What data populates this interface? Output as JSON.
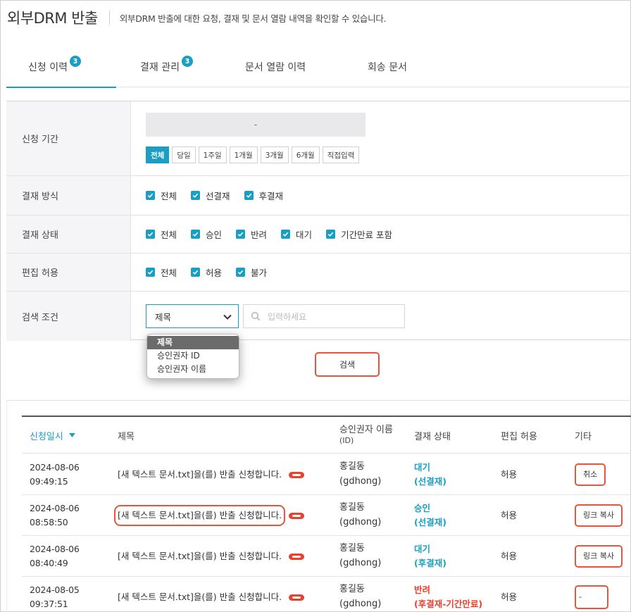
{
  "header": {
    "title": "외부DRM 반출",
    "description": "외부DRM 반출에 대한 요청, 결재 및 문서 열람 내역을 확인할 수 있습니다."
  },
  "tabs": [
    {
      "label": "신청 이력",
      "badge": "3",
      "active": true
    },
    {
      "label": "결재 관리",
      "badge": "3",
      "active": false
    },
    {
      "label": "문서 열람 이력",
      "badge": "",
      "active": false
    },
    {
      "label": "회송 문서",
      "badge": "",
      "active": false
    }
  ],
  "filters": {
    "period": {
      "label": "신청 기간",
      "range_separator": "-",
      "options": [
        "전체",
        "당일",
        "1주일",
        "1개월",
        "3개월",
        "6개월",
        "직접입력"
      ],
      "selected": "전체"
    },
    "approval_method": {
      "label": "결재 방식",
      "options": [
        "전체",
        "선결재",
        "후결재"
      ]
    },
    "approval_status": {
      "label": "결재 상태",
      "options": [
        "전체",
        "승인",
        "반려",
        "대기",
        "기간만료 포함"
      ]
    },
    "edit_permission": {
      "label": "편집 허용",
      "options": [
        "전체",
        "허용",
        "불가"
      ]
    },
    "search_condition": {
      "label": "검색 조건",
      "selected": "제목",
      "dropdown_options": [
        "제목",
        "승인권자 ID",
        "승인권자 이름"
      ],
      "placeholder": "입력하세요"
    },
    "search_button": "검색"
  },
  "table": {
    "columns": [
      "신청일시",
      "제목",
      "승인권자 이름",
      "(ID)",
      "결재 상태",
      "편집 허용",
      "기타"
    ],
    "rows": [
      {
        "date": "2024-08-06",
        "time": "09:49:15",
        "subject": "[새 텍스트 문서.txt]을(를) 반출 신청합니다.",
        "approver_name": "홍길동",
        "approver_id": "(gdhong)",
        "status": "대기",
        "status_sub": "(선결재)",
        "status_type": "approve",
        "edit": "허용",
        "etc": "취소"
      },
      {
        "date": "2024-08-06",
        "time": "08:58:50",
        "subject": "[새 텍스트 문서.txt]을(를) 반출 신청합니다.",
        "approver_name": "홍길동",
        "approver_id": "(gdhong)",
        "status": "승인",
        "status_sub": "(선결재)",
        "status_type": "approve",
        "edit": "허용",
        "etc": "링크 복사"
      },
      {
        "date": "2024-08-06",
        "time": "08:40:49",
        "subject": "[새 텍스트 문서.txt]을(를) 반출 신청합니다.",
        "approver_name": "홍길동",
        "approver_id": "(gdhong)",
        "status": "대기",
        "status_sub": "(후결재)",
        "status_type": "approve",
        "edit": "허용",
        "etc": "링크 복사"
      },
      {
        "date": "2024-08-05",
        "time": "09:37:51",
        "subject": "[새 텍스트 문서.txt]을(를) 반출 신청합니다.",
        "approver_name": "홍길동",
        "approver_id": "(gdhong)",
        "status": "반려",
        "status_sub": "(후결재-기간만료)",
        "status_type": "reject",
        "edit": "허용",
        "etc": "-"
      }
    ]
  },
  "colors": {
    "accent": "#1a9ec4",
    "highlight": "#e8553c",
    "reject": "#e8412c"
  }
}
